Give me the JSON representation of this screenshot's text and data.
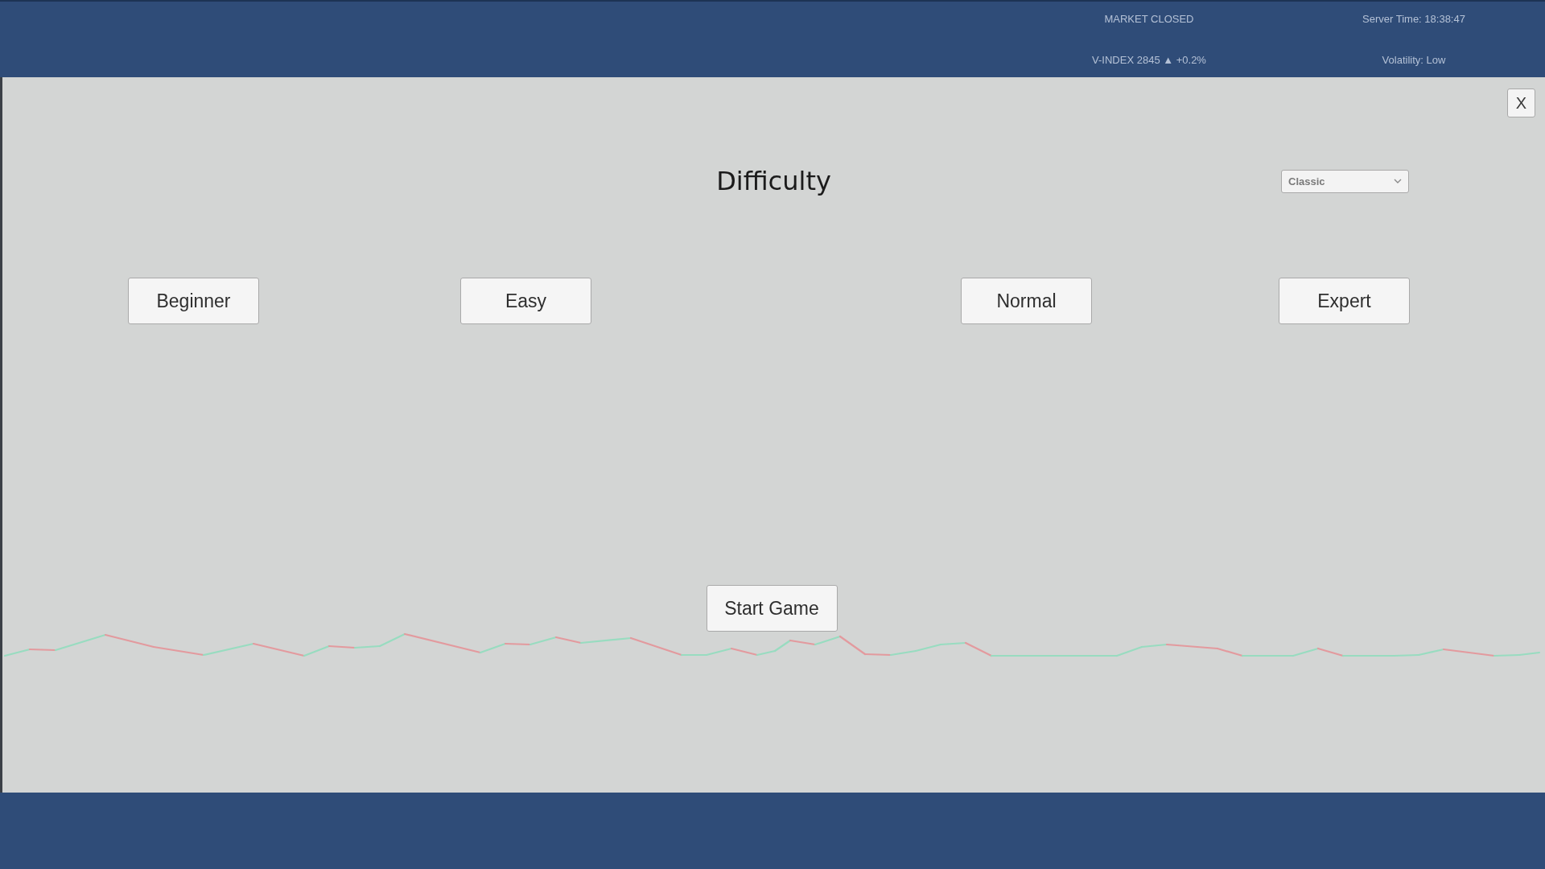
{
  "header": {
    "market_status": "MARKET CLOSED",
    "server_time": "Server Time: 18:38:47",
    "index": "V-INDEX 2845 ▲ +0.2%",
    "volatility": "Volatility: Low"
  },
  "dialog": {
    "close_label": "X",
    "title": "Difficulty",
    "mode_select": {
      "value": "Classic"
    },
    "difficulty_options": [
      {
        "label": "Beginner",
        "selected": false
      },
      {
        "label": "Easy",
        "selected": false
      },
      {
        "label": "Normal",
        "selected": false
      },
      {
        "label": "Expert",
        "selected": false
      }
    ],
    "start_button": "Start Game"
  }
}
